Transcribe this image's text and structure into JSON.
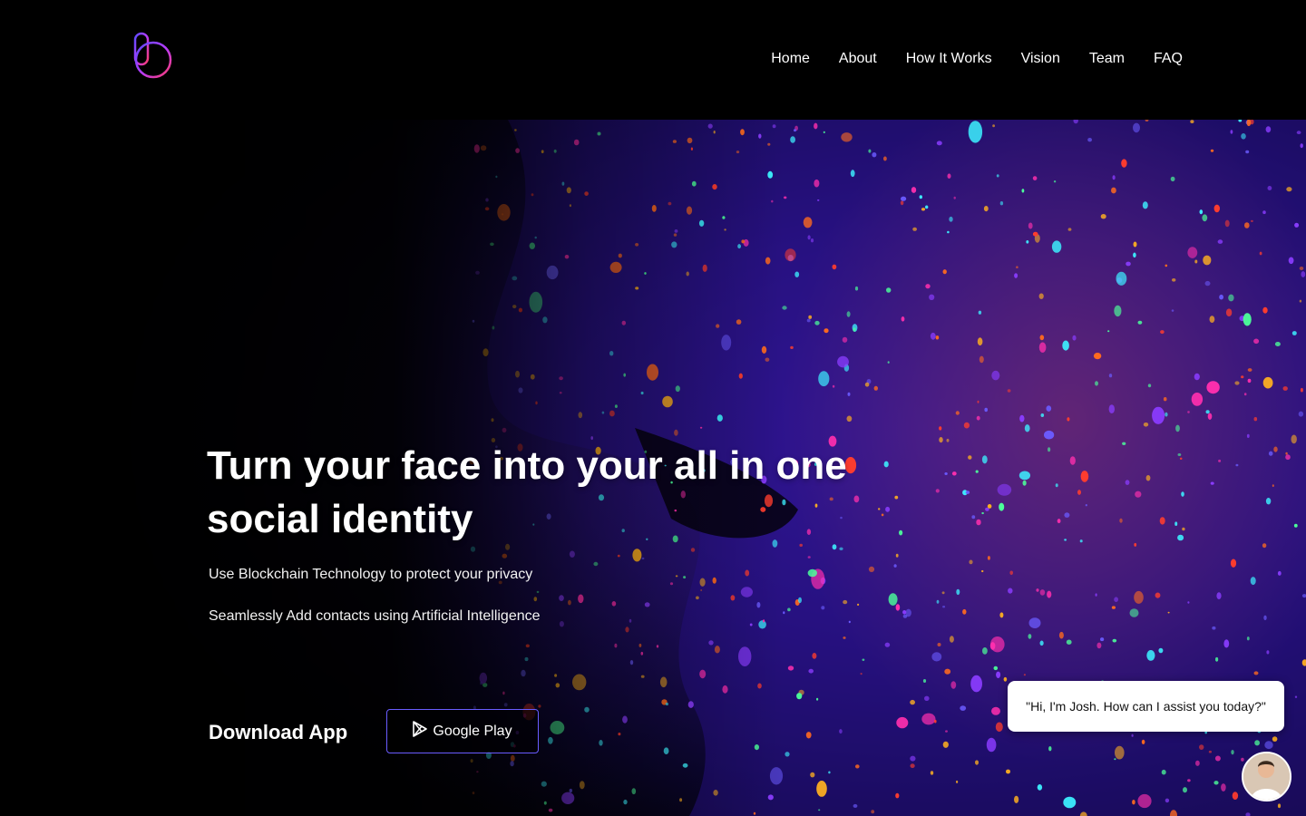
{
  "brand": {
    "logo_icon": "gradient-b-logo-icon",
    "colors": {
      "logo_start": "#5b4bff",
      "logo_end": "#ff3b6b",
      "button_border": "#6a5cff"
    }
  },
  "nav": {
    "items": [
      {
        "label": "Home"
      },
      {
        "label": "About"
      },
      {
        "label": "How It Works"
      },
      {
        "label": "Vision"
      },
      {
        "label": "Team"
      },
      {
        "label": "FAQ"
      }
    ]
  },
  "hero": {
    "headline_line1": "Turn your face into your all in one",
    "headline_line2": "social identity",
    "subtitle1": "Use Blockchain Technology to protect your privacy",
    "subtitle2": "Seamlessly Add contacts using Artificial Intelligence",
    "download_label": "Download App",
    "google_play_label": "Google Play",
    "google_play_icon": "play-store-icon"
  },
  "chat": {
    "message": "\"Hi, I'm Josh. How can I assist you today?\"",
    "avatar_icon": "assistant-avatar"
  }
}
